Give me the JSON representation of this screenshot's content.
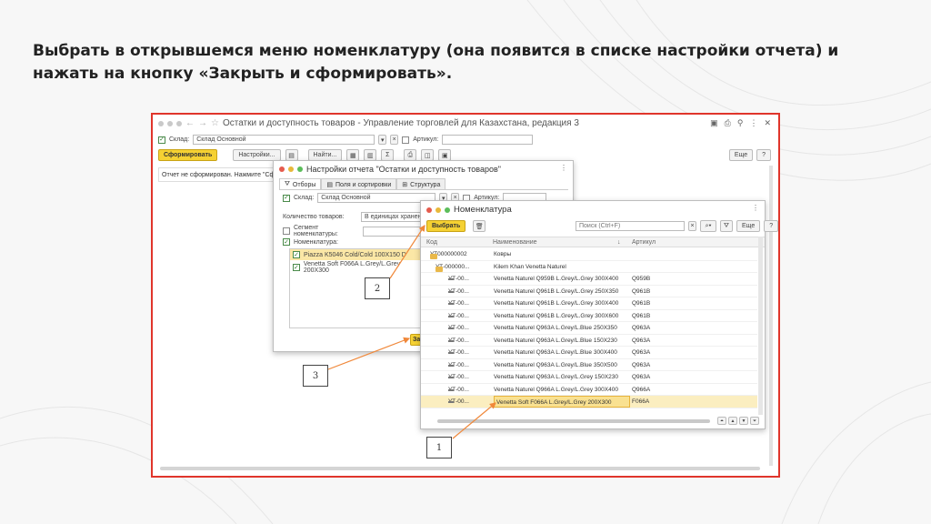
{
  "instruction": "Выбрать в открывшемся меню номенклатуру (она появится в списке настройки отчета) и нажать на кнопку «Закрыть и сформировать».",
  "colors": {
    "accent_red": "#e0352b",
    "button_yellow": "#f5d133",
    "highlight": "#fbeec0",
    "arrow": "#f0883a"
  },
  "main_window": {
    "title": "Остатки и доступность товаров - Управление торговлей для Казахстана, редакция 3",
    "warehouse_label": "Склад:",
    "warehouse_value": "Склад Основной",
    "article_label": "Артикул:",
    "generate_button": "Сформировать",
    "settings_button": "Настройки...",
    "find_button": "Найти...",
    "more_button": "Еще",
    "help_button": "?",
    "status_text": "Отчет не сформирован. Нажмите \"Сформ",
    "icons": [
      "star-icon",
      "save-icon",
      "print-icon",
      "link-icon",
      "more-icon",
      "close-icon"
    ]
  },
  "settings_dialog": {
    "title": "Настройки отчета \"Остатки и доступность товаров\"",
    "tabs": [
      "Отборы",
      "Поля и сортировки",
      "Структура"
    ],
    "warehouse_label": "Склад:",
    "warehouse_value": "Склад Основной",
    "article_label": "Артикул:",
    "quantity_label": "Количество товаров:",
    "quantity_value": "В единицах хранения",
    "segment_label": "Сегмент номенклатуры:",
    "nomenclature_label": "Номенклатура:",
    "items": [
      "Piazza K5046 Cold/Cold 100X150 D",
      "Venetta Soft F066A L.Grey/L.Grey 200X300"
    ],
    "close_button_partial": "За"
  },
  "nomenclature_dialog": {
    "title": "Номенклатура",
    "select_button": "Выбрать",
    "search_placeholder": "Поиск (Ctrl+F)",
    "more_button": "Еще",
    "help_button": "?",
    "columns": {
      "code": "Код",
      "name": "Наименование",
      "sort": "↓",
      "article": "Артикул"
    },
    "rows": [
      {
        "code": "УТ000000002",
        "name": "Ковры",
        "article": "",
        "kind": "folder",
        "level": 0
      },
      {
        "code": "УТ-000000...",
        "name": "Kilem Khan Venetta Naturel",
        "article": "",
        "kind": "folder",
        "level": 1
      },
      {
        "code": "УТ-00...",
        "name": "Venetta Naturel Q959B L.Grey/L.Grey 300X400",
        "article": "Q959B",
        "kind": "item",
        "level": 2
      },
      {
        "code": "УТ-00...",
        "name": "Venetta Naturel Q961B L.Grey/L.Grey 250X350",
        "article": "Q961B",
        "kind": "item",
        "level": 2
      },
      {
        "code": "УТ-00...",
        "name": "Venetta Naturel Q961B L.Grey/L.Grey 300X400",
        "article": "Q961B",
        "kind": "item",
        "level": 2
      },
      {
        "code": "УТ-00...",
        "name": "Venetta Naturel Q961B L.Grey/L.Grey 300X600",
        "article": "Q961B",
        "kind": "item",
        "level": 2
      },
      {
        "code": "УТ-00...",
        "name": "Venetta Naturel Q963A L.Grey/L.Blue 250X350",
        "article": "Q963A",
        "kind": "item",
        "level": 2
      },
      {
        "code": "УТ-00...",
        "name": "Venetta Naturel Q963A L.Grey/L.Blue 150X230",
        "article": "Q963A",
        "kind": "item",
        "level": 2
      },
      {
        "code": "УТ-00...",
        "name": "Venetta Naturel Q963A L.Grey/L.Blue 300X400",
        "article": "Q963A",
        "kind": "item",
        "level": 2
      },
      {
        "code": "УТ-00...",
        "name": "Venetta Naturel Q963A L.Grey/L.Blue 350X500",
        "article": "Q963A",
        "kind": "item",
        "level": 2
      },
      {
        "code": "УТ-00...",
        "name": "Venetta Naturel Q963A L.Grey/L.Grey 150X230",
        "article": "Q963A",
        "kind": "item",
        "level": 2
      },
      {
        "code": "УТ-00...",
        "name": "Venetta Naturel Q966A L.Grey/L.Grey 300X400",
        "article": "Q966A",
        "kind": "item",
        "level": 2
      },
      {
        "code": "УТ-00...",
        "name": "Venetta Soft F066A L.Grey/L.Grey 200X300",
        "article": "F066A",
        "kind": "item",
        "level": 2,
        "selected": true
      }
    ]
  },
  "callouts": [
    "1",
    "2",
    "3"
  ]
}
